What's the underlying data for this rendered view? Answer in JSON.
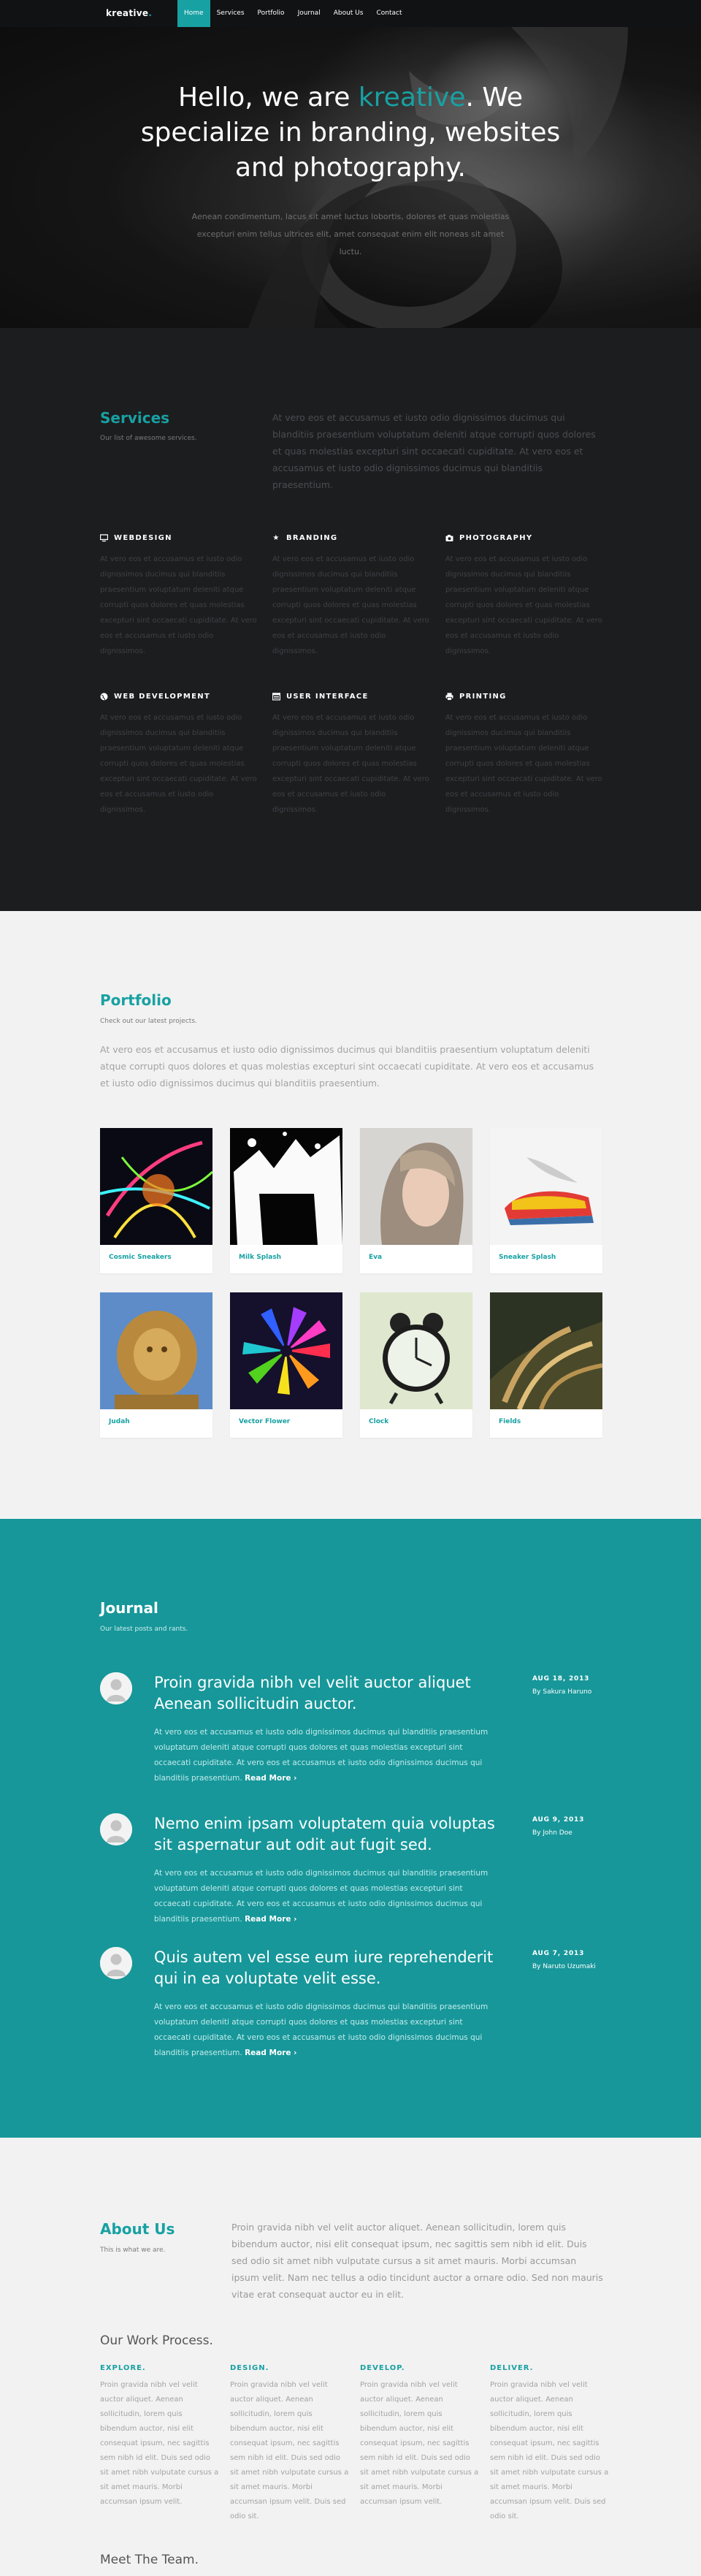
{
  "nav": {
    "logo": "kreative",
    "logo_dot": ".",
    "items": [
      "Home",
      "Services",
      "Portfolio",
      "Journal",
      "About Us",
      "Contact"
    ]
  },
  "hero": {
    "title_before": "Hello, we are ",
    "title_accent": "kreative",
    "title_after": ". We specialize in branding, websites and photography.",
    "subtitle": "Aenean condimentum, lacus sit amet luctus lobortis, dolores et quas molestias excepturi enim tellus ultrices elit, amet consequat enim elit noneas sit amet luctu."
  },
  "services": {
    "title": "Services",
    "subtitle": "Our list of awesome services.",
    "lead": "At vero eos et accusamus et iusto odio dignissimos ducimus qui blanditiis praesentium voluptatum deleniti atque corrupti quos dolores et quas molestias excepturi sint occaecati cupiditate. At vero eos et accusamus et iusto odio dignissimos ducimus qui blanditiis praesentium.",
    "items": [
      {
        "icon": "monitor-icon",
        "title": "WEBDESIGN",
        "text": "At vero eos et accusamus et iusto odio dignissimos ducimus qui blanditiis praesentium voluptatum deleniti atque corrupti quos dolores et quas molestias excepturi sint occaecati cupiditate. At vero eos et accusamus et iusto odio dignissimos."
      },
      {
        "icon": "star-icon",
        "title": "BRANDING",
        "text": "At vero eos et accusamus et iusto odio dignissimos ducimus qui blanditiis praesentium voluptatum deleniti atque corrupti quos dolores et quas molestias excepturi sint occaecati cupiditate. At vero eos et accusamus et iusto odio dignissimos."
      },
      {
        "icon": "camera-icon",
        "title": "PHOTOGRAPHY",
        "text": "At vero eos et accusamus et iusto odio dignissimos ducimus qui blanditiis praesentium voluptatum deleniti atque corrupti quos dolores et quas molestias excepturi sint occaecati cupiditate. At vero eos et accusamus et iusto odio dignissimos."
      },
      {
        "icon": "globe-icon",
        "title": "WEB DEVELOPMENT",
        "text": "At vero eos et accusamus et iusto odio dignissimos ducimus qui blanditiis praesentium voluptatum deleniti atque corrupti quos dolores et quas molestias excepturi sint occaecati cupiditate. At vero eos et accusamus et iusto odio dignissimos."
      },
      {
        "icon": "window-icon",
        "title": "USER INTERFACE",
        "text": "At vero eos et accusamus et iusto odio dignissimos ducimus qui blanditiis praesentium voluptatum deleniti atque corrupti quos dolores et quas molestias excepturi sint occaecati cupiditate. At vero eos et accusamus et iusto odio dignissimos."
      },
      {
        "icon": "printer-icon",
        "title": "PRINTING",
        "text": "At vero eos et accusamus et iusto odio dignissimos ducimus qui blanditiis praesentium voluptatum deleniti atque corrupti quos dolores et quas molestias excepturi sint occaecati cupiditate. At vero eos et accusamus et iusto odio dignissimos."
      }
    ]
  },
  "portfolio": {
    "title": "Portfolio",
    "subtitle": "Check out our latest projects.",
    "lead": "At vero eos et accusamus et iusto odio dignissimos ducimus qui blanditiis praesentium voluptatum deleniti atque corrupti quos dolores et quas molestias excepturi sint occaecati cupiditate. At vero eos et accusamus et iusto odio dignissimos ducimus qui blanditiis praesentium.",
    "items": [
      "Cosmic Sneakers",
      "Milk Splash",
      "Eva",
      "Sneaker Splash",
      "Judah",
      "Vector Flower",
      "Clock",
      "Fields"
    ]
  },
  "journal": {
    "title": "Journal",
    "subtitle": "Our latest posts and rants.",
    "read_more": "Read More",
    "posts": [
      {
        "title": "Proin gravida nibh vel velit auctor aliquet Aenean sollicitudin auctor.",
        "body": "At vero eos et accusamus et iusto odio dignissimos ducimus qui blanditiis praesentium voluptatum deleniti atque corrupti quos dolores et quas molestias excepturi sint occaecati cupiditate. At vero eos et accusamus et iusto odio dignissimos ducimus qui blanditiis praesentium.",
        "date": "AUG 18, 2013",
        "author": "By Sakura Haruno"
      },
      {
        "title": "Nemo enim ipsam voluptatem quia voluptas sit aspernatur aut odit aut fugit sed.",
        "body": "At vero eos et accusamus et iusto odio dignissimos ducimus qui blanditiis praesentium voluptatum deleniti atque corrupti quos dolores et quas molestias excepturi sint occaecati cupiditate. At vero eos et accusamus et iusto odio dignissimos ducimus qui blanditiis praesentium.",
        "date": "AUG 9, 2013",
        "author": "By John Doe"
      },
      {
        "title": "Quis autem vel esse eum iure reprehenderit qui in ea voluptate velit esse.",
        "body": "At vero eos et accusamus et iusto odio dignissimos ducimus qui blanditiis praesentium voluptatum deleniti atque corrupti quos dolores et quas molestias excepturi sint occaecati cupiditate. At vero eos et accusamus et iusto odio dignissimos ducimus qui blanditiis praesentium.",
        "date": "AUG 7, 2013",
        "author": "By Naruto Uzumaki"
      }
    ]
  },
  "about": {
    "title": "About Us",
    "subtitle": "This is what we are.",
    "lead": "Proin gravida nibh vel velit auctor aliquet. Aenean sollicitudin, lorem quis bibendum auctor, nisi elit consequat ipsum, nec sagittis sem nibh id elit. Duis sed odio sit amet nibh vulputate cursus a sit amet mauris. Morbi accumsan ipsum velit. Nam nec tellus a odio tincidunt auctor a ornare odio. Sed non mauris vitae erat consequat auctor eu in elit.",
    "process_title": "Our Work Process.",
    "process": [
      {
        "title": "EXPLORE.",
        "text": "Proin gravida nibh vel velit auctor aliquet. Aenean sollicitudin, lorem quis bibendum auctor, nisi elit consequat ipsum, nec sagittis sem nibh id elit. Duis sed odio sit amet nibh vulputate cursus a sit amet mauris. Morbi accumsan ipsum velit."
      },
      {
        "title": "DESIGN.",
        "text": "Proin gravida nibh vel velit auctor aliquet. Aenean sollicitudin, lorem quis bibendum auctor, nisi elit consequat ipsum, nec sagittis sem nibh id elit. Duis sed odio sit amet nibh vulputate cursus a sit amet mauris. Morbi accumsan ipsum velit. Duis sed odio sit."
      },
      {
        "title": "DEVELOP.",
        "text": "Proin gravida nibh vel velit auctor aliquet. Aenean sollicitudin, lorem quis bibendum auctor, nisi elit consequat ipsum, nec sagittis sem nibh id elit. Duis sed odio sit amet nibh vulputate cursus a sit amet mauris. Morbi accumsan ipsum velit."
      },
      {
        "title": "DELIVER.",
        "text": "Proin gravida nibh vel velit auctor aliquet. Aenean sollicitudin, lorem quis bibendum auctor, nisi elit consequat ipsum, nec sagittis sem nibh id elit. Duis sed odio sit amet nibh vulputate cursus a sit amet mauris. Morbi accumsan ipsum velit. Duis sed odio sit."
      }
    ],
    "team_title": "Meet The Team."
  },
  "colors": {
    "accent": "#18a1a3",
    "journal_bg": "#17979a",
    "dark_bg": "#1c1d1f",
    "light_bg": "#f2f2f2"
  }
}
